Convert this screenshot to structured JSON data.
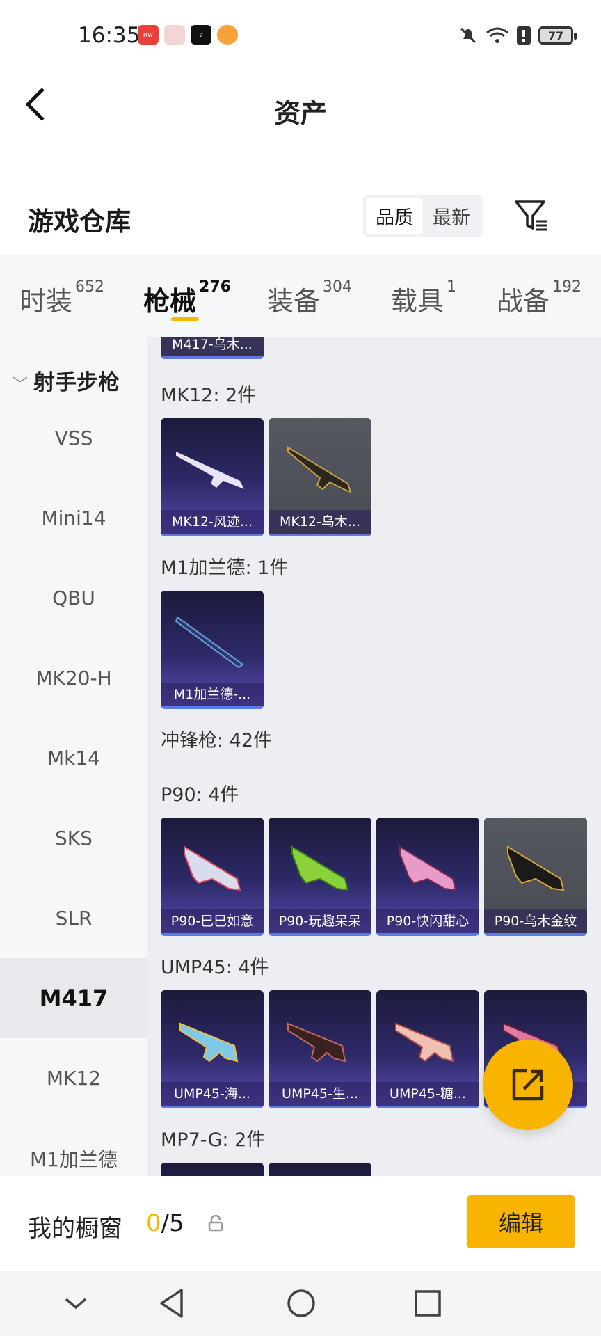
{
  "status_bar": {
    "time": "16:35",
    "battery": "77",
    "app_icons": [
      "huawei-app-icon",
      "gift-box-icon",
      "tiktok-icon",
      "fox-app-icon"
    ],
    "right_icons": [
      "mute-bell-icon",
      "wifi-icon",
      "sim-icon",
      "battery-icon"
    ]
  },
  "header": {
    "title": "资产"
  },
  "section": {
    "title": "游戏仓库",
    "sort_options": [
      "品质",
      "最新"
    ],
    "active_sort": "品质"
  },
  "tabs": [
    {
      "label": "时装",
      "count": "652"
    },
    {
      "label": "枪械",
      "count": "276"
    },
    {
      "label": "装备",
      "count": "304"
    },
    {
      "label": "载具",
      "count": "1"
    },
    {
      "label": "战备",
      "count": "192"
    }
  ],
  "active_tab": "枪械",
  "sidebar": {
    "category": "射手步枪",
    "items": [
      "VSS",
      "Mini14",
      "QBU",
      "MK20-H",
      "Mk14",
      "SKS",
      "SLR",
      "M417",
      "MK12",
      "M1加兰德"
    ],
    "active_item": "M417"
  },
  "content": {
    "partial_top_card": "M417-乌木...",
    "groups": [
      {
        "title": "MK12: 2件",
        "items": [
          "MK12-风迹...",
          "MK12-乌木..."
        ]
      },
      {
        "title": "M1加兰德: 1件",
        "items": [
          "M1加兰德-..."
        ]
      },
      {
        "title": "冲锋枪: 42件",
        "items": []
      },
      {
        "title": "P90: 4件",
        "items": [
          "P90-巳巳如意",
          "P90-玩趣呆呆",
          "P90-快闪甜心",
          "P90-乌木金纹"
        ]
      },
      {
        "title": "UMP45: 4件",
        "items": [
          "UMP45-海...",
          "UMP45-生...",
          "UMP45-糖...",
          ""
        ]
      },
      {
        "title": "MP7-G: 2件",
        "items": []
      }
    ]
  },
  "showcase": {
    "label": "我的橱窗",
    "count": "0",
    "total": "/5",
    "edit_label": "编辑"
  },
  "colors": {
    "accent": "#f9b400",
    "card_purple": "#2e2a6a",
    "card_grey": "#4f5158"
  }
}
